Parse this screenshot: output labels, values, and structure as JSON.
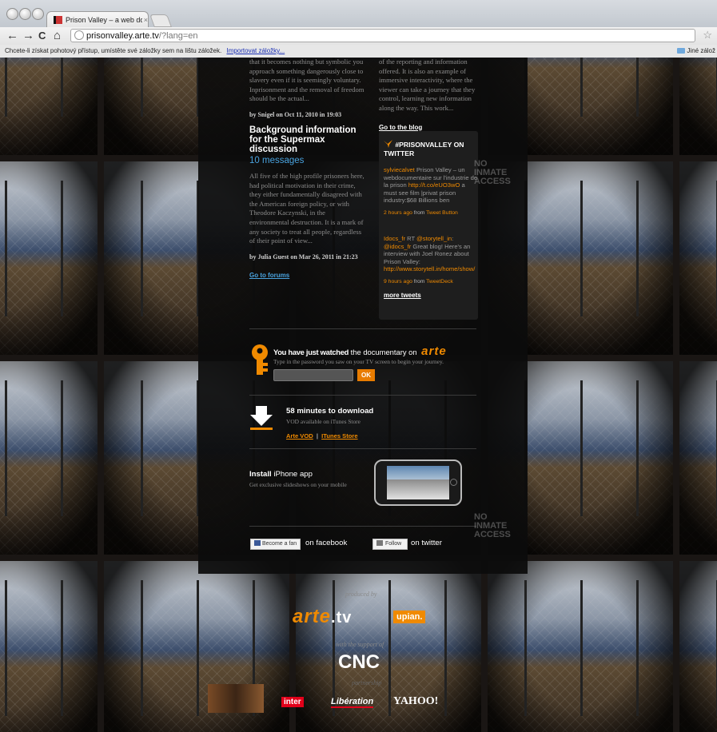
{
  "browser": {
    "tab_title": "Prison Valley – a web docum",
    "tab_close": "×",
    "url_host": "prisonvalley.arte.tv",
    "url_path": "/?lang=en",
    "bookmarks_bar_text": "Chcete-li získat pohotový přístup, umístěte své záložky sem na lištu záložek.",
    "bookmarks_import_link": "Importovat záložky...",
    "other_bookmarks": "Jiné zálož",
    "nav_back": "←",
    "nav_forward": "→",
    "nav_reload": "C",
    "nav_home": "⌂",
    "star": "☆"
  },
  "blog_left": {
    "excerpt": "that it becomes nothing but symbolic you approach something dangerously close to slavery even if it is seemingly voluntary. Inprisonment and the removal of freedom should be the actual...",
    "byline": "by Snigel on Oct 11, 2010 in 19:03",
    "headline": "Background information for the Supermax discussion",
    "count": "10 messages",
    "excerpt2": "All five of the high profile prisoners here, had political motivation in their crime, they either fundamentally disagreed with the American foreign policy, or with Theodore Kaczynski, in the environmental destruction. It is a mark of any society to treat all people, regardless of their point of view...",
    "byline2": "by Julia Guest on Mar 26, 2011 in 21:23",
    "forums_link": "Go to forums"
  },
  "blog_right": {
    "excerpt": "of the reporting and information offered. It is also an example of immersive interactivity, where the viewer can take a journey that they control, learning new information along the way. This work...",
    "blog_link": "Go to the blog"
  },
  "twitter": {
    "title": "#PRISONVALLEY ON TWITTER",
    "tweet1_user": "sylviecalvet",
    "tweet1_text": " Prison Valley – un webdocumentaire sur l'industrie de la prison ",
    "tweet1_link": "http://t.co/eUO3wO",
    "tweet1_text2": " a must see film |privat prison industry:$68 Billions ben",
    "tweet1_time": "2 hours ago",
    "tweet1_from": " from ",
    "tweet1_app": "Tweet Button",
    "tweet2_user": "Idocs_fr",
    "tweet2_rt": " RT ",
    "tweet2_mention": "@storytell_in",
    "tweet2_colon": ": ",
    "tweet2_mention2": "@idocs_fr",
    "tweet2_text": " Great blog! Here's an interview with Joel Ronez about Prison Valley: ",
    "tweet2_link": "http://www.storytell.in/home/show/",
    "tweet2_time": "9 hours ago",
    "tweet2_from": " from ",
    "tweet2_app": "TweetDeck",
    "more": "more tweets"
  },
  "documentary": {
    "lead_bold": "You have just watched",
    "lead_rest": " the documentary on",
    "brand": "arte",
    "hint": "Type in the password you saw on your TV screen to begin your journey.",
    "ok": "OK"
  },
  "download": {
    "title": "58 minutes to download",
    "subtitle": "VOD available on iTunes Store",
    "link1": "Arte VOD",
    "sep": "|",
    "link2": "ITunes Store"
  },
  "iphone": {
    "title_bold": "Install",
    "title_rest": " iPhone app",
    "subtitle": "Get exclusive slideshows on your mobile"
  },
  "social": {
    "fb_button": "Become a fan",
    "fb_text": "on facebook",
    "tw_button": "Follow",
    "tw_text": "on twitter"
  },
  "footer": {
    "produced_by": "produced by",
    "arte_logo": "arte",
    "arte_tv": ".tv",
    "upian": "upian.",
    "support": "with the support of",
    "cnc": "CNC",
    "partners_label": "partnership",
    "inter": "inter",
    "liberation": "Libération",
    "yahoo": "YAHOO!"
  },
  "signs": {
    "no_inmate": "NO\nINMATE\nACCESS"
  },
  "colors": {
    "accent_orange": "#f08a00",
    "link_blue": "#4aa3df",
    "panel_bg": "#0c0c0c"
  }
}
